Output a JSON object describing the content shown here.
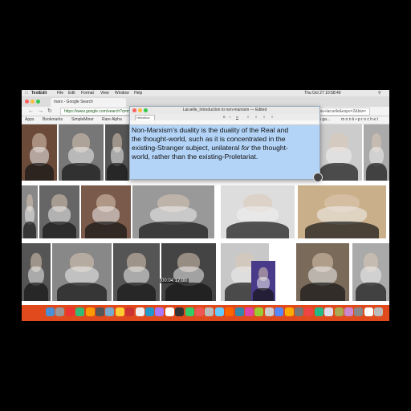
{
  "menubar": {
    "app": "TextEdit",
    "items": [
      "File",
      "Edit",
      "Format",
      "View",
      "Window",
      "Help"
    ],
    "clock": "Thu Oct 27  10:58:49"
  },
  "browser": {
    "tab_search": "marx - Google Search",
    "url": "https://www.google.com/search?q=marx",
    "right_url": "...rlp=francois+laruelle&espv=2&biw=",
    "bookmarks": [
      "Apps",
      "Bookmarks",
      "SimpleMiner",
      "Rare Alpha",
      "Times Twin ga...",
      "m o n k • p r o c h e t"
    ]
  },
  "textedit": {
    "title": "Laruelle_Introduction to non-marxism — Edited",
    "font_field": "Helvetica",
    "line1": "Non-Marxism’s duality is the duality of the Real and",
    "line2": "the thought-world, such as it is concentrated in the",
    "line3": "existing-Stranger subject, unilateral ",
    "line3_em": "for",
    "line3_end": " the thought-",
    "line4": "world, rather than the existing-Proletariat."
  },
  "video": {
    "timestamp": "00:04:17:00"
  },
  "colors": {
    "dock": "#e04a1c",
    "textedit_bg": "#b3d4f7"
  }
}
